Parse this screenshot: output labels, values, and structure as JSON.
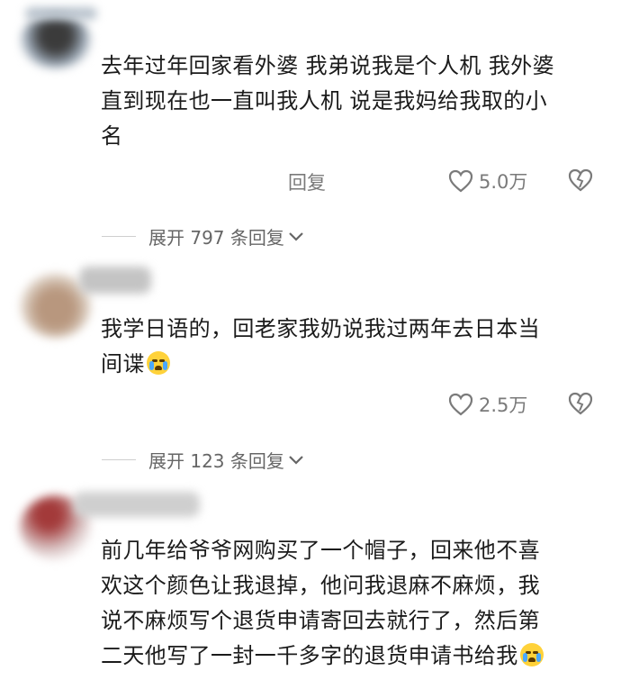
{
  "comments": [
    {
      "lines": [
        "去年过年回家看外婆 我弟说我是个人机 我外婆",
        "直到现在也一直叫我人机 说是我妈给我取的小",
        "名"
      ],
      "reply_label": "回复",
      "likes": "5.0万",
      "expand_label": "展开 797 条回复"
    },
    {
      "lines": [
        "我学日语的，回老家我奶说我过两年去日本当",
        "间谍"
      ],
      "likes": "2.5万",
      "expand_label": "展开 123 条回复"
    },
    {
      "lines": [
        "前几年给爷爷网购买了一个帽子，回来他不喜",
        "欢这个颜色让我退掉，他问我退麻不麻烦，我",
        "说不麻烦写个退货申请寄回去就行了，然后第",
        "二天他写了一封一千多字的退货申请书给我"
      ]
    }
  ],
  "icons": {
    "like": "heart-outline-icon",
    "dislike": "broken-heart-icon",
    "expand": "chevron-down-icon",
    "emoji": "crying-face-emoji"
  }
}
